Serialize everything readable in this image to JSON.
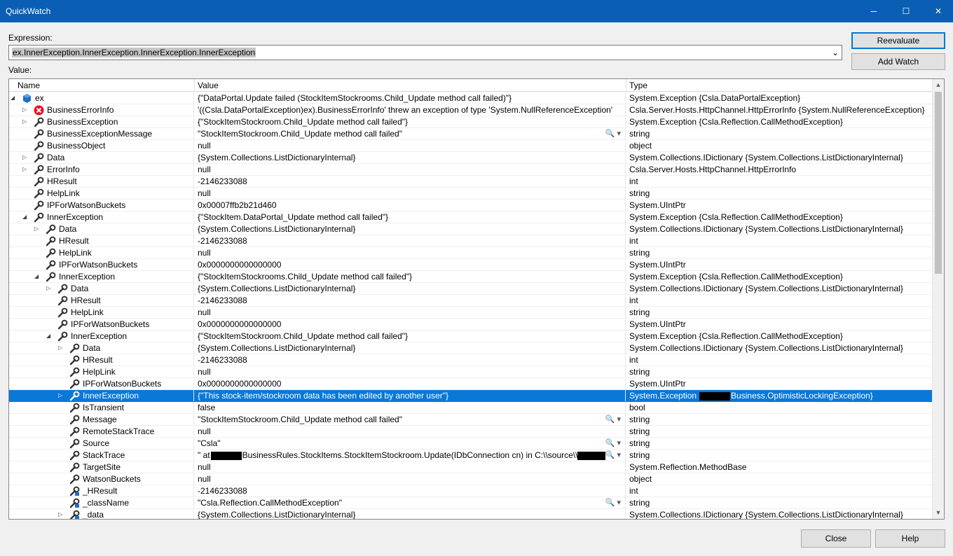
{
  "window": {
    "title": "QuickWatch",
    "minimize_glyph": "─",
    "maximize_glyph": "☐",
    "close_glyph": "✕"
  },
  "expression": {
    "label": "Expression:",
    "value": "ex.InnerException.InnerException.InnerException.InnerException",
    "dropdown_glyph": "⌄"
  },
  "value_label": "Value:",
  "buttons": {
    "reevaluate": "Reevaluate",
    "add_watch": "Add Watch",
    "close": "Close",
    "help": "Help"
  },
  "columns": {
    "name": "Name",
    "value": "Value",
    "type": "Type"
  },
  "icons": {
    "expand_collapsed": "expand-arrow-icon",
    "expand_open": "collapse-arrow-icon",
    "object": "object-cube-icon",
    "error": "error-icon",
    "property": "wrench-property-icon",
    "field": "private-field-icon",
    "search": "magnifier-icon",
    "colors": {
      "titlebar": "#0a5fb4",
      "selection": "#0a78d7",
      "error": "#e81123"
    }
  },
  "rows": [
    {
      "depth": 0,
      "expander": "open",
      "icon": "object",
      "name": "ex",
      "value": "{\"DataPortal.Update failed (StockItemStockrooms.Child_Update method call failed)\"}",
      "type": "System.Exception {Csla.DataPortalException}"
    },
    {
      "depth": 1,
      "expander": "closed",
      "icon": "error",
      "name": "BusinessErrorInfo",
      "value": "'((Csla.DataPortalException)ex).BusinessErrorInfo' threw an exception of type 'System.NullReferenceException'",
      "type": "Csla.Server.Hosts.HttpChannel.HttpErrorInfo {System.NullReferenceException}"
    },
    {
      "depth": 1,
      "expander": "closed",
      "icon": "property",
      "name": "BusinessException",
      "value": "{\"StockItemStockroom.Child_Update method call failed\"}",
      "type": "System.Exception {Csla.Reflection.CallMethodException}"
    },
    {
      "depth": 1,
      "expander": "none",
      "icon": "property",
      "name": "BusinessExceptionMessage",
      "value": "\"StockItemStockroom.Child_Update method call failed\"",
      "type": "string",
      "search": true
    },
    {
      "depth": 1,
      "expander": "none",
      "icon": "property",
      "name": "BusinessObject",
      "value": "null",
      "type": "object"
    },
    {
      "depth": 1,
      "expander": "closed",
      "icon": "property",
      "name": "Data",
      "value": "{System.Collections.ListDictionaryInternal}",
      "type": "System.Collections.IDictionary {System.Collections.ListDictionaryInternal}"
    },
    {
      "depth": 1,
      "expander": "closed",
      "icon": "property",
      "name": "ErrorInfo",
      "value": "null",
      "type": "Csla.Server.Hosts.HttpChannel.HttpErrorInfo"
    },
    {
      "depth": 1,
      "expander": "none",
      "icon": "property",
      "name": "HResult",
      "value": "-2146233088",
      "type": "int"
    },
    {
      "depth": 1,
      "expander": "none",
      "icon": "property",
      "name": "HelpLink",
      "value": "null",
      "type": "string"
    },
    {
      "depth": 1,
      "expander": "none",
      "icon": "property",
      "name": "IPForWatsonBuckets",
      "value": "0x00007ffb2b21d460",
      "type": "System.UIntPtr"
    },
    {
      "depth": 1,
      "expander": "open",
      "icon": "property",
      "name": "InnerException",
      "value": "{\"StockItem.DataPortal_Update method call failed\"}",
      "type": "System.Exception {Csla.Reflection.CallMethodException}"
    },
    {
      "depth": 2,
      "expander": "closed",
      "icon": "property",
      "name": "Data",
      "value": "{System.Collections.ListDictionaryInternal}",
      "type": "System.Collections.IDictionary {System.Collections.ListDictionaryInternal}"
    },
    {
      "depth": 2,
      "expander": "none",
      "icon": "property",
      "name": "HResult",
      "value": "-2146233088",
      "type": "int"
    },
    {
      "depth": 2,
      "expander": "none",
      "icon": "property",
      "name": "HelpLink",
      "value": "null",
      "type": "string"
    },
    {
      "depth": 2,
      "expander": "none",
      "icon": "property",
      "name": "IPForWatsonBuckets",
      "value": "0x0000000000000000",
      "type": "System.UIntPtr"
    },
    {
      "depth": 2,
      "expander": "open",
      "icon": "property",
      "name": "InnerException",
      "value": "{\"StockItemStockrooms.Child_Update method call failed\"}",
      "type": "System.Exception {Csla.Reflection.CallMethodException}"
    },
    {
      "depth": 3,
      "expander": "closed",
      "icon": "property",
      "name": "Data",
      "value": "{System.Collections.ListDictionaryInternal}",
      "type": "System.Collections.IDictionary {System.Collections.ListDictionaryInternal}"
    },
    {
      "depth": 3,
      "expander": "none",
      "icon": "property",
      "name": "HResult",
      "value": "-2146233088",
      "type": "int"
    },
    {
      "depth": 3,
      "expander": "none",
      "icon": "property",
      "name": "HelpLink",
      "value": "null",
      "type": "string"
    },
    {
      "depth": 3,
      "expander": "none",
      "icon": "property",
      "name": "IPForWatsonBuckets",
      "value": "0x0000000000000000",
      "type": "System.UIntPtr"
    },
    {
      "depth": 3,
      "expander": "open",
      "icon": "property",
      "name": "InnerException",
      "value": "{\"StockItemStockroom.Child_Update method call failed\"}",
      "type": "System.Exception {Csla.Reflection.CallMethodException}"
    },
    {
      "depth": 4,
      "expander": "closed",
      "icon": "property",
      "name": "Data",
      "value": "{System.Collections.ListDictionaryInternal}",
      "type": "System.Collections.IDictionary {System.Collections.ListDictionaryInternal}"
    },
    {
      "depth": 4,
      "expander": "none",
      "icon": "property",
      "name": "HResult",
      "value": "-2146233088",
      "type": "int"
    },
    {
      "depth": 4,
      "expander": "none",
      "icon": "property",
      "name": "HelpLink",
      "value": "null",
      "type": "string"
    },
    {
      "depth": 4,
      "expander": "none",
      "icon": "property",
      "name": "IPForWatsonBuckets",
      "value": "0x0000000000000000",
      "type": "System.UIntPtr"
    },
    {
      "depth": 4,
      "expander": "closed",
      "icon": "property",
      "name": "InnerException",
      "value": "{\"This stock-item/stockroom data has been edited by another user\"}",
      "type": "System.Exception",
      "type_suffix": "Business.OptimisticLockingException}",
      "redact_type": true,
      "selected": true
    },
    {
      "depth": 4,
      "expander": "none",
      "icon": "property",
      "name": "IsTransient",
      "value": "false",
      "type": "bool"
    },
    {
      "depth": 4,
      "expander": "none",
      "icon": "property",
      "name": "Message",
      "value": "\"StockItemStockroom.Child_Update method call failed\"",
      "type": "string",
      "search": true
    },
    {
      "depth": 4,
      "expander": "none",
      "icon": "property",
      "name": "RemoteStackTrace",
      "value": "null",
      "type": "string"
    },
    {
      "depth": 4,
      "expander": "none",
      "icon": "property",
      "name": "Source",
      "value": "\"Csla\"",
      "type": "string",
      "search": true
    },
    {
      "depth": 4,
      "expander": "none",
      "icon": "property",
      "name": "StackTrace",
      "value": "\"   at",
      "value_suffix": "BusinessRules.StockItems.StockItemStockroom.Update(IDbConnection cn) in C:\\\\source\\\\",
      "redact_value": true,
      "type": "string",
      "search": true
    },
    {
      "depth": 4,
      "expander": "none",
      "icon": "property",
      "name": "TargetSite",
      "value": "null",
      "type": "System.Reflection.MethodBase"
    },
    {
      "depth": 4,
      "expander": "none",
      "icon": "property",
      "name": "WatsonBuckets",
      "value": "null",
      "type": "object"
    },
    {
      "depth": 4,
      "expander": "none",
      "icon": "field",
      "name": "_HResult",
      "value": "-2146233088",
      "type": "int"
    },
    {
      "depth": 4,
      "expander": "none",
      "icon": "field",
      "name": "_className",
      "value": "\"Csla.Reflection.CallMethodException\"",
      "type": "string",
      "search": true
    },
    {
      "depth": 4,
      "expander": "closed",
      "icon": "field",
      "name": "_data",
      "value": "{System.Collections.ListDictionaryInternal}",
      "type": "System.Collections.IDictionary {System.Collections.ListDictionaryInternal}"
    }
  ],
  "scroll_glyphs": {
    "up": "▲",
    "down": "▼"
  },
  "search_glyph": "🔍 ▾"
}
